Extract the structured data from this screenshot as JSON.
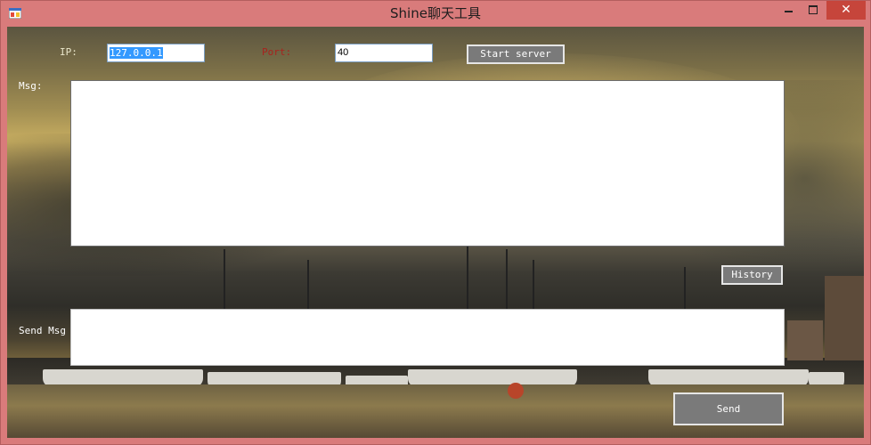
{
  "window": {
    "title": "Shine聊天工具",
    "app_icon": "app-window-icon",
    "controls": {
      "minimize_icon": "minimize-icon",
      "maximize_icon": "maximize-icon",
      "close_icon": "close-icon",
      "close_glyph": "✕"
    },
    "accent_color": "#d97b7b",
    "close_color": "#c6453b"
  },
  "connection": {
    "ip_label": "IP:",
    "ip_value": "127.0.0.1",
    "port_label": "Port:",
    "port_value": "40",
    "start_button_label": "Start server"
  },
  "messages": {
    "msg_label": "Msg:",
    "msg_value": "",
    "history_button_label": "History"
  },
  "compose": {
    "send_msg_label": "Send Msg",
    "send_value": "",
    "send_button_label": "Send"
  }
}
